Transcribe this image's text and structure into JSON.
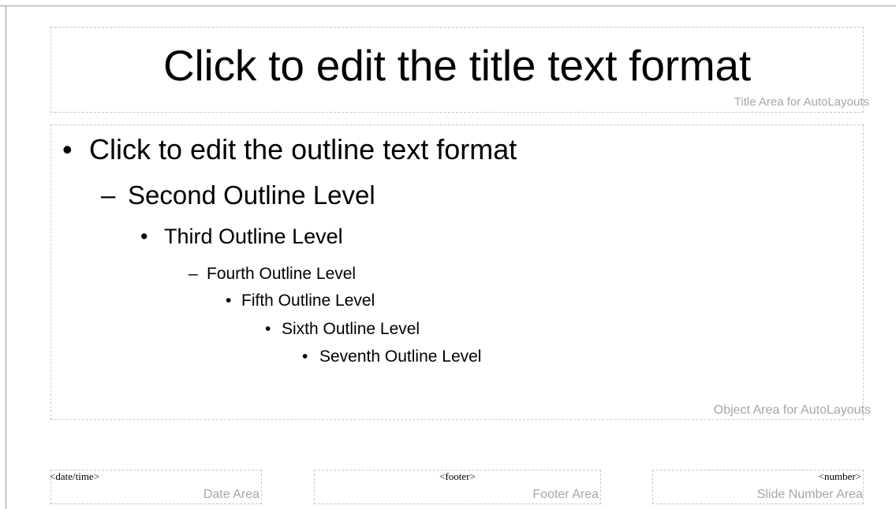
{
  "title_area": {
    "text": "Click to edit the title text format",
    "area_label": "Title Area for AutoLayouts"
  },
  "object_area": {
    "outline": [
      {
        "bullet": "•",
        "text": "Click to edit the outline text format"
      },
      {
        "bullet": "–",
        "text": "Second Outline Level"
      },
      {
        "bullet": "•",
        "text": "Third Outline Level"
      },
      {
        "bullet": "–",
        "text": "Fourth Outline Level"
      },
      {
        "bullet": "•",
        "text": "Fifth Outline Level"
      },
      {
        "bullet": "•",
        "text": "Sixth Outline Level"
      },
      {
        "bullet": "•",
        "text": "Seventh Outline Level"
      }
    ],
    "area_label": "Object Area for AutoLayouts"
  },
  "date_area": {
    "field": "<date/time>",
    "area_label": "Date Area"
  },
  "footer_area": {
    "field": "<footer>",
    "area_label": "Footer Area"
  },
  "number_area": {
    "field": "<number>",
    "area_label": "Slide Number Area"
  }
}
